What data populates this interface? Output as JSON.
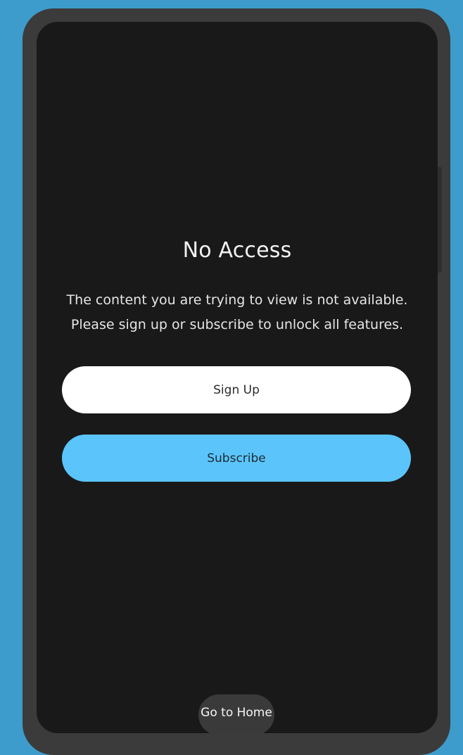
{
  "screen": {
    "title": "No Access",
    "message": "The content you are trying to view is not available. Please sign up or subscribe to unlock all features."
  },
  "buttons": {
    "sign_up_label": "Sign Up",
    "subscribe_label": "Subscribe"
  },
  "navigation": {
    "home_label": "Go to Home"
  },
  "colors": {
    "background": "#3d9ccb",
    "device_frame": "#3b3b3b",
    "screen": "#191919",
    "sign_up_button": "#ffffff",
    "subscribe_button": "#5bc5fb"
  }
}
